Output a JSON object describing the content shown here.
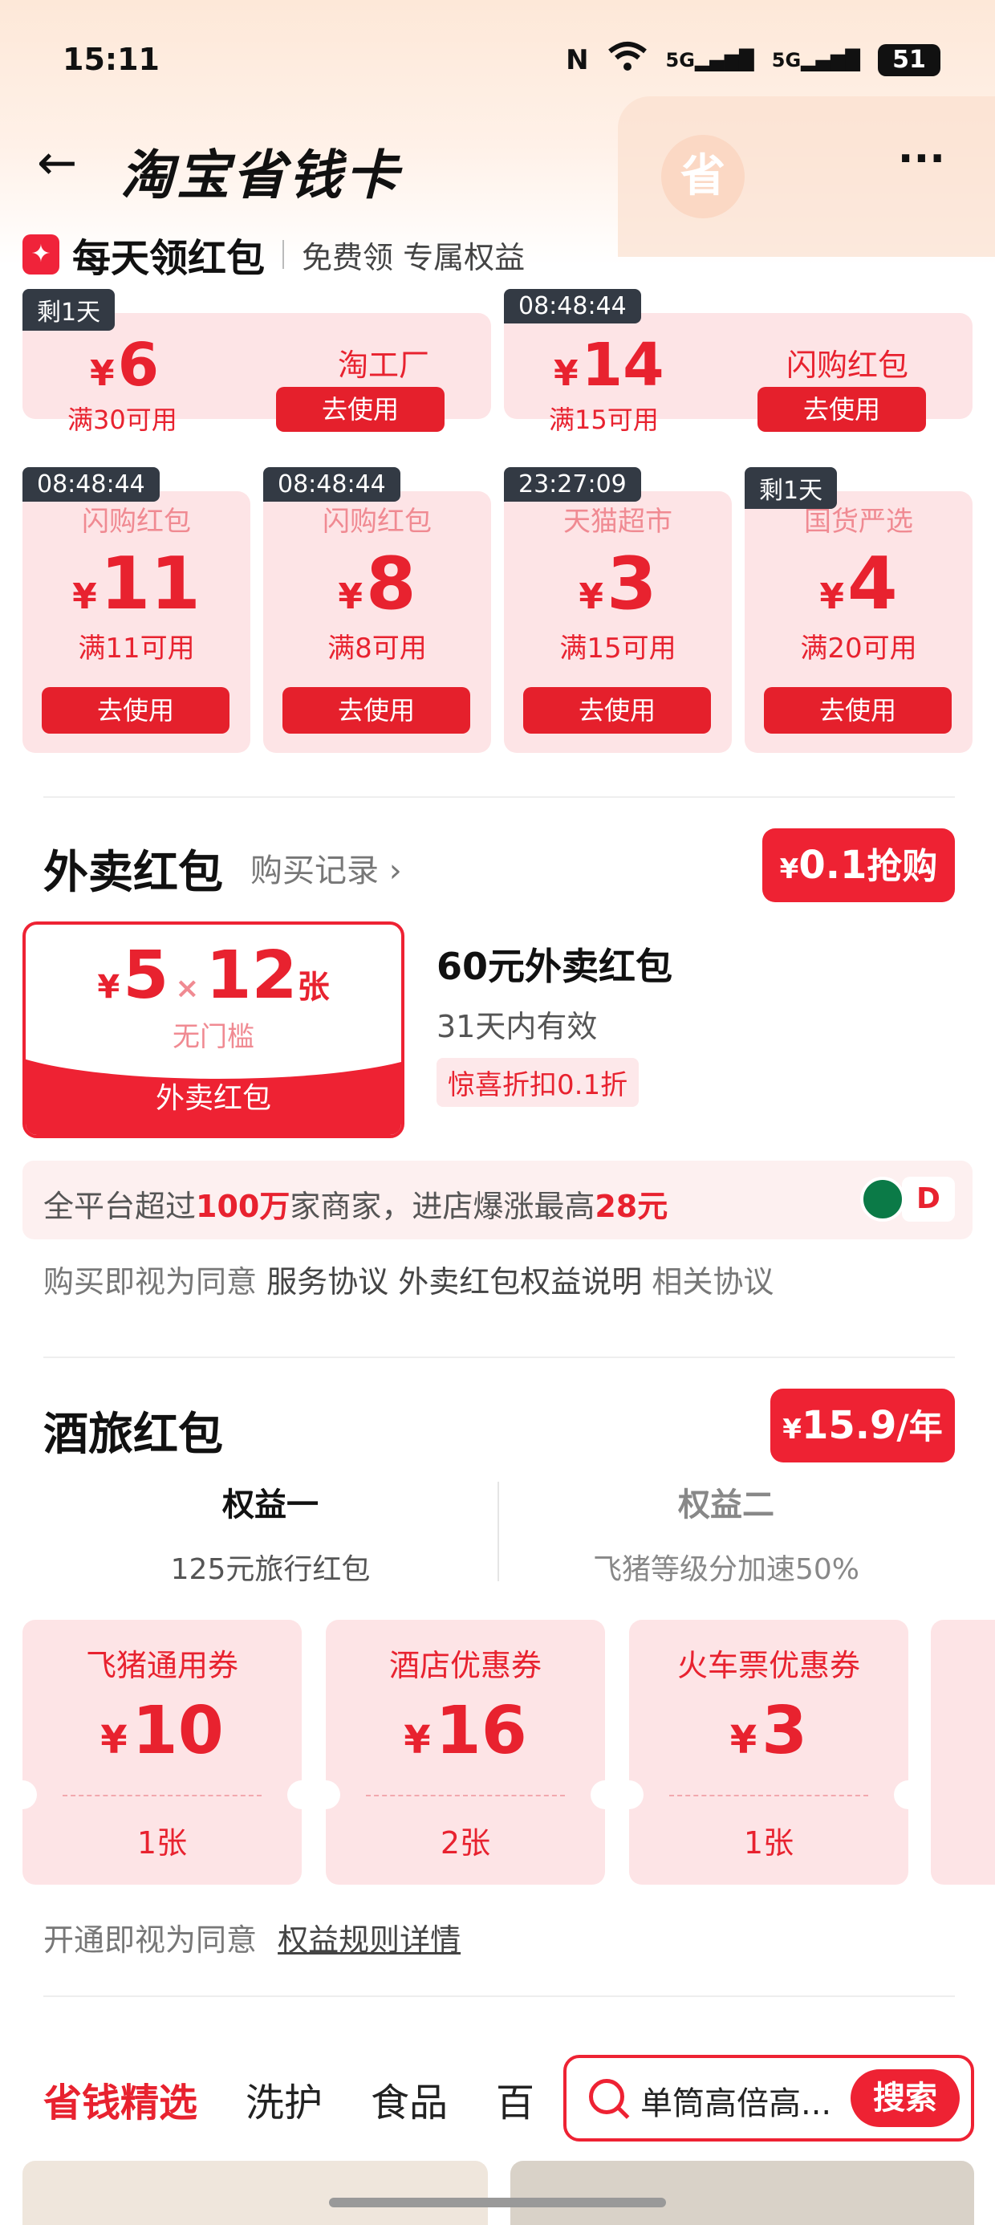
{
  "status_bar": {
    "time": "15:11",
    "nfc": "N",
    "wifi": "wifi",
    "sig1": "5G",
    "sig2": "5G",
    "battery": "51"
  },
  "header": {
    "back": "←",
    "title": "淘宝省钱卡",
    "more": "···",
    "badge": "省"
  },
  "daily": {
    "title": "每天领红包",
    "subtitle": "免费领 专属权益"
  },
  "top_coupons": [
    {
      "tag": "剩1天",
      "value": "6",
      "condition": "满30可用",
      "name": "淘工厂",
      "button": "去使用"
    },
    {
      "tag": "08:48:44",
      "value": "14",
      "condition": "满15可用",
      "name": "闪购红包",
      "button": "去使用"
    }
  ],
  "small_coupons": [
    {
      "tag": "08:48:44",
      "name": "闪购红包",
      "value": "11",
      "condition": "满11可用",
      "button": "去使用"
    },
    {
      "tag": "08:48:44",
      "name": "闪购红包",
      "value": "8",
      "condition": "满8可用",
      "button": "去使用"
    },
    {
      "tag": "23:27:09",
      "name": "天猫超市",
      "value": "3",
      "condition": "满15可用",
      "button": "去使用"
    },
    {
      "tag": "剩1天",
      "name": "国货严选",
      "value": "4",
      "condition": "满20可用",
      "button": "去使用"
    }
  ],
  "waimai": {
    "title": "外卖红包",
    "record_link": "购买记录 ›",
    "buy": {
      "yen": "¥",
      "price": "0.1",
      "label": "抢购"
    },
    "card": {
      "value": "5",
      "times": "×",
      "count": "12",
      "unit": "张",
      "desc": "无门槛",
      "label": "外卖红包"
    },
    "name": "60元外卖红包",
    "validity": "31天内有效",
    "discount": "惊喜折扣0.1折",
    "info": {
      "pre": "全平台超过",
      "num1": "100万",
      "mid": "家商家，进店爆涨最高",
      "num2": "28元"
    },
    "agree": {
      "pre": "购买即视为同意",
      "link1": "服务协议",
      "link2": "外卖红包权益说明",
      "link3": "相关协议"
    }
  },
  "travel": {
    "title": "酒旅红包",
    "buy": {
      "yen": "¥",
      "price": "15.9",
      "unit": "/年"
    },
    "benefits": [
      {
        "title": "权益一",
        "desc": "125元旅行红包"
      },
      {
        "title": "权益二",
        "desc": "飞猪等级分加速50%"
      }
    ],
    "coupons": [
      {
        "name": "飞猪通用券",
        "value": "10",
        "count": "1张"
      },
      {
        "name": "酒店优惠券",
        "value": "16",
        "count": "2张"
      },
      {
        "name": "火车票优惠券",
        "value": "3",
        "count": "1张"
      }
    ],
    "agree": {
      "pre": "开通即视为同意",
      "link": "权益规则详情"
    }
  },
  "bottom": {
    "tabs": [
      "省钱精选",
      "洗护",
      "食品",
      "百"
    ],
    "search_text": "单筒高倍高...",
    "search_button": "搜索"
  },
  "colors": {
    "brand_red": "#ee2233",
    "card_pink": "#fde4e6",
    "tag_dark": "#333a44"
  }
}
